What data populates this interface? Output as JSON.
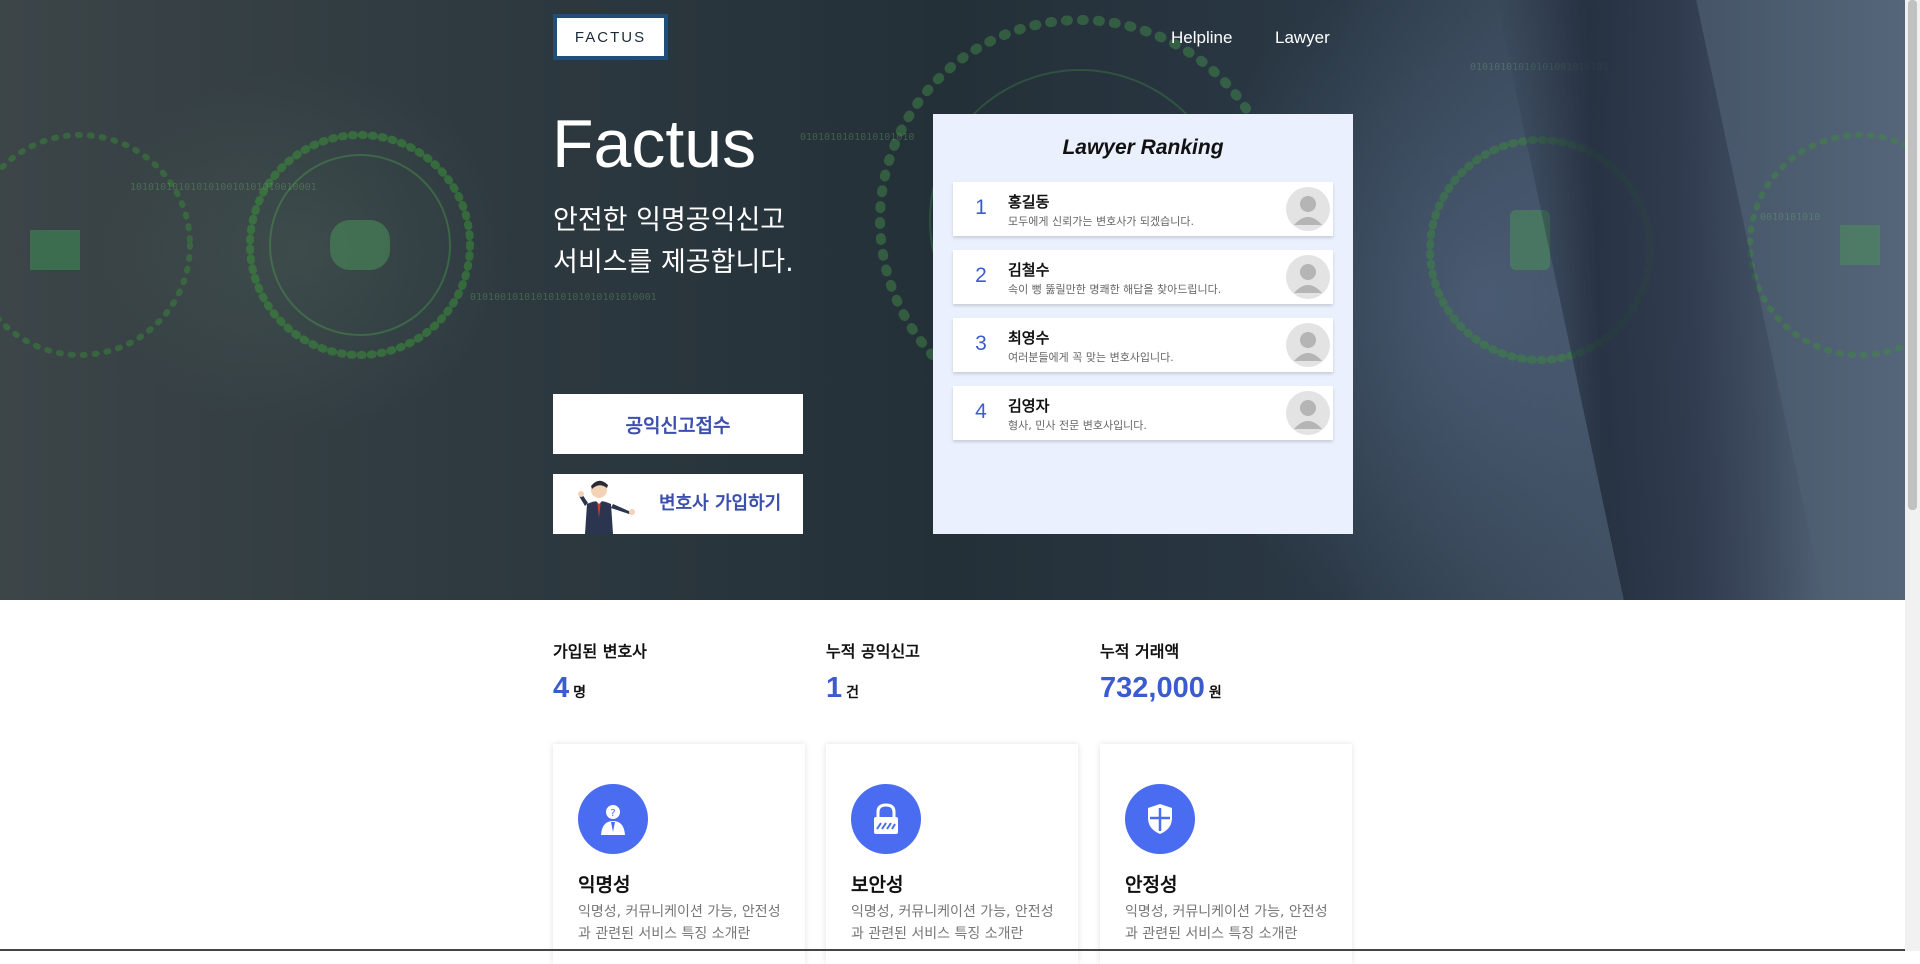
{
  "header": {
    "logo_text": "FACTUS",
    "nav": [
      {
        "label": "Helpline"
      },
      {
        "label": "Lawyer"
      }
    ]
  },
  "hero": {
    "title": "Factus",
    "subtitle_line1": "안전한 익명공익신고",
    "subtitle_line2": "서비스를 제공합니다.",
    "report_button_label": "공익신고접수",
    "join_button_label": "변호사 가입하기"
  },
  "ranking": {
    "title": "Lawyer Ranking",
    "items": [
      {
        "rank": "1",
        "name": "홍길동",
        "desc": "모두에게 신뢰가는 변호사가 되겠습니다."
      },
      {
        "rank": "2",
        "name": "김철수",
        "desc": "속이 뻥 뚫릴만한 명쾌한 해답을 찾아드립니다."
      },
      {
        "rank": "3",
        "name": "최영수",
        "desc": "여러분들에게 꼭 맞는 변호사입니다."
      },
      {
        "rank": "4",
        "name": "김영자",
        "desc": "형사, 민사 전문 변호사입니다."
      }
    ]
  },
  "stats": [
    {
      "label": "가입된 변호사",
      "value": "4",
      "unit": "명"
    },
    {
      "label": "누적 공익신고",
      "value": "1",
      "unit": "건"
    },
    {
      "label": "누적 거래액",
      "value": "732,000",
      "unit": "원"
    }
  ],
  "features": [
    {
      "icon": "anonymous-person-icon",
      "title": "익명성",
      "desc": "익명성, 커뮤니케이션 가능, 안전성과 관련된 서비스 특징 소개란"
    },
    {
      "icon": "lock-icon",
      "title": "보안성",
      "desc": "익명성, 커뮤니케이션 가능, 안전성과 관련된 서비스 특징 소개란"
    },
    {
      "icon": "shield-icon",
      "title": "안정성",
      "desc": "익명성, 커뮤니케이션 가능, 안전성과 관련된 서비스 특징 소개란"
    }
  ],
  "colors": {
    "accent": "#3c5bd0",
    "button_text": "#3c4fb0",
    "ranking_bg": "#eaf0fd",
    "feature_icon_bg": "#4a6cf0",
    "logo_border": "#1f4e79"
  }
}
